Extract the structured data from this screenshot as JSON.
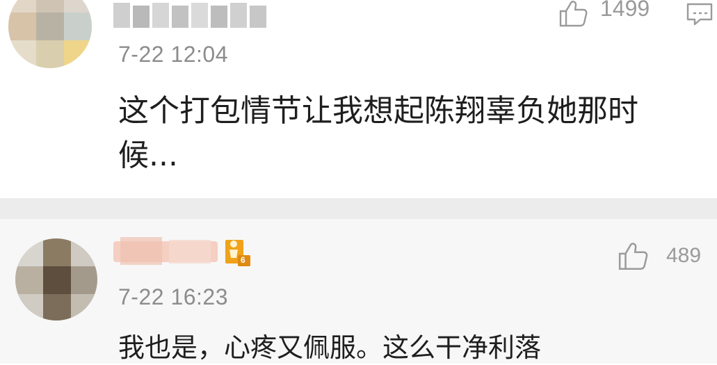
{
  "comments": [
    {
      "timestamp": "7-22 12:04",
      "text_line1": "这个打包情节让我想起陈翔辜负她那时",
      "text_line2": "候...",
      "like_count": "1499"
    },
    {
      "timestamp": "7-22 16:23",
      "text_line1": "我也是，心疼又佩服。这么干净利落",
      "like_count": "489",
      "badge_level": "6"
    }
  ],
  "colors": {
    "meta_gray": "#8c8c8c",
    "divider": "#ececec",
    "badge_gold": "#f0a21a"
  },
  "icons": [
    "thumbs-up-icon",
    "reply-icon",
    "level-badge-icon"
  ]
}
